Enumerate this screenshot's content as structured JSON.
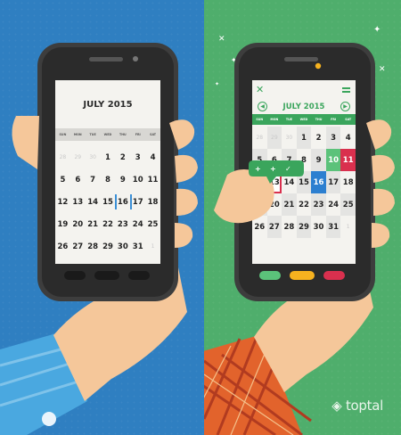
{
  "brand": {
    "name": "toptal"
  },
  "colors": {
    "left_bg": "#2f7fc1",
    "right_bg": "#4fae6c",
    "green": "#3aa55c",
    "red": "#d9304e",
    "yellow": "#f6b21f",
    "blue": "#2c7fd0"
  },
  "icons": [
    "close-icon",
    "menu-icon",
    "prev-month-icon",
    "next-month-icon",
    "sparkle-icon",
    "toptal-logo-icon"
  ],
  "left_calendar": {
    "title": "JULY 2015",
    "weekdays": [
      "SUN",
      "MON",
      "TUE",
      "WED",
      "THU",
      "FRI",
      "SAT"
    ],
    "weeks": [
      [
        "28",
        "29",
        "30",
        "1",
        "2",
        "3",
        "4"
      ],
      [
        "5",
        "6",
        "7",
        "8",
        "9",
        "10",
        "11"
      ],
      [
        "12",
        "13",
        "14",
        "15",
        "16",
        "17",
        "18"
      ],
      [
        "19",
        "20",
        "21",
        "22",
        "23",
        "24",
        "25"
      ],
      [
        "26",
        "27",
        "28",
        "29",
        "30",
        "31",
        "1"
      ]
    ]
  },
  "right_calendar": {
    "title": "JULY 2015",
    "prev_label": "◀",
    "next_label": "▶",
    "weekdays": [
      "SUN",
      "MON",
      "TUE",
      "WED",
      "THU",
      "FRI",
      "SAT"
    ],
    "weeks": [
      [
        "28",
        "29",
        "30",
        "1",
        "2",
        "3",
        "4"
      ],
      [
        "5",
        "6",
        "7",
        "8",
        "9",
        "10",
        "11"
      ],
      [
        "12",
        "13",
        "14",
        "15",
        "16",
        "17",
        "18"
      ],
      [
        "19",
        "20",
        "21",
        "22",
        "23",
        "24",
        "25"
      ],
      [
        "26",
        "27",
        "28",
        "29",
        "30",
        "31",
        "1"
      ]
    ],
    "bubble_icons": [
      "+",
      "+",
      "✓"
    ]
  },
  "bottom_buttons": [
    "green",
    "yellow",
    "red"
  ]
}
